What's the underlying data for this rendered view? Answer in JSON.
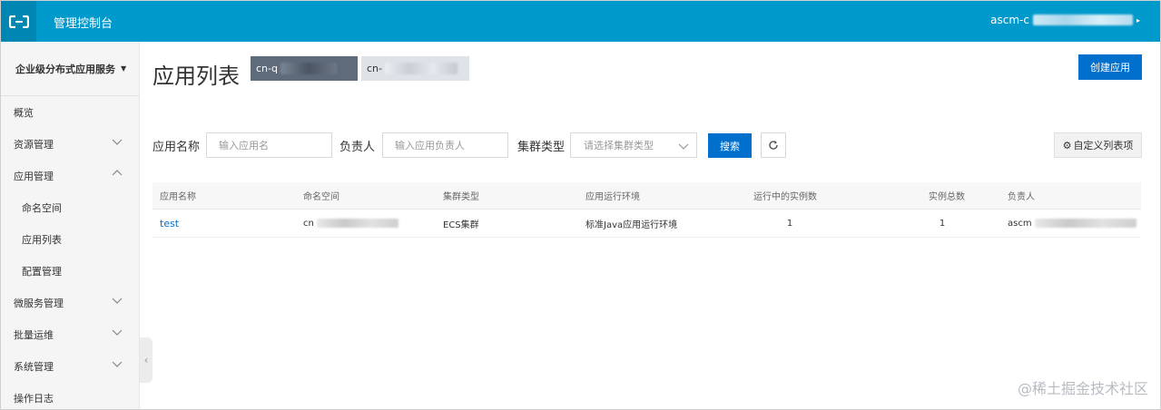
{
  "header": {
    "console_title": "管理控制台",
    "user_prefix": "ascm-c",
    "user_caret": "▸"
  },
  "sidebar": {
    "product_title": "企业级分布式应用服务",
    "items": [
      {
        "label": "概览",
        "sub": false,
        "chevron": "none"
      },
      {
        "label": "资源管理",
        "sub": false,
        "chevron": "down"
      },
      {
        "label": "应用管理",
        "sub": false,
        "chevron": "up"
      },
      {
        "label": "命名空间",
        "sub": true,
        "chevron": "none"
      },
      {
        "label": "应用列表",
        "sub": true,
        "chevron": "none"
      },
      {
        "label": "配置管理",
        "sub": true,
        "chevron": "none"
      },
      {
        "label": "微服务管理",
        "sub": false,
        "chevron": "down"
      },
      {
        "label": "批量运维",
        "sub": false,
        "chevron": "down"
      },
      {
        "label": "系统管理",
        "sub": false,
        "chevron": "down"
      },
      {
        "label": "操作日志",
        "sub": false,
        "chevron": "none"
      }
    ]
  },
  "main": {
    "page_title": "应用列表",
    "region_tag_1": "cn-q",
    "region_tag_2": "cn-",
    "create_button": "创建应用",
    "filters": {
      "app_name_label": "应用名称",
      "app_name_placeholder": "输入应用名",
      "owner_label": "负责人",
      "owner_placeholder": "输入应用负责人",
      "cluster_label": "集群类型",
      "cluster_placeholder": "请选择集群类型",
      "search_button": "搜索",
      "custom_columns_button": "自定义列表项"
    },
    "table": {
      "headers": [
        "应用名称",
        "命名空间",
        "集群类型",
        "应用运行环境",
        "运行中的实例数",
        "实例总数",
        "负责人"
      ],
      "rows": [
        {
          "name": "test",
          "namespace": "cn",
          "cluster": "ECS集群",
          "runtime": "标准Java应用运行环境",
          "running": "1",
          "total": "1",
          "owner": "ascm"
        }
      ]
    }
  },
  "watermark": "@稀土掘金技术社区",
  "colors": {
    "topbar": "#0099cc",
    "primary": "#0070cc",
    "tag_dark": "#5e6b7a"
  }
}
